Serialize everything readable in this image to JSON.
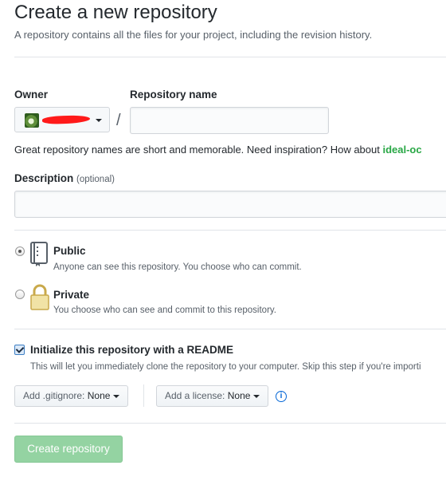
{
  "header": {
    "title": "Create a new repository",
    "subtitle": "A repository contains all the files for your project, including the revision history."
  },
  "owner": {
    "label": "Owner",
    "selected": ""
  },
  "slash": "/",
  "repo_name": {
    "label": "Repository name",
    "value": "",
    "placeholder": ""
  },
  "hint": {
    "text": "Great repository names are short and memorable. Need inspiration? How about ",
    "suggestion": "ideal-oc"
  },
  "description": {
    "label": "Description",
    "optional": "(optional)",
    "value": ""
  },
  "visibility": {
    "selected": "public",
    "public": {
      "title": "Public",
      "desc": "Anyone can see this repository. You choose who can commit."
    },
    "private": {
      "title": "Private",
      "desc": "You choose who can see and commit to this repository."
    }
  },
  "readme": {
    "checked": true,
    "title": "Initialize this repository with a README",
    "desc": "This will let you immediately clone the repository to your computer. Skip this step if you're importi"
  },
  "gitignore": {
    "prefix": "Add .gitignore:",
    "value": "None"
  },
  "license": {
    "prefix": "Add a license:",
    "value": "None"
  },
  "info_icon": "i",
  "submit": {
    "label": "Create repository"
  },
  "colors": {
    "suggestion": "#28a745",
    "submit_bg": "#94d3a2",
    "info": "#0366d6"
  }
}
